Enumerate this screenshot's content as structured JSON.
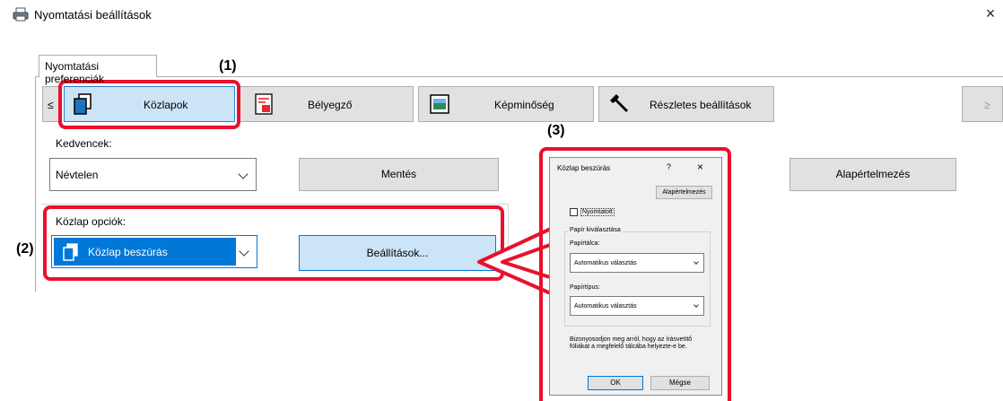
{
  "window": {
    "title": "Nyomtatási beállítások",
    "close_glyph": "×"
  },
  "tab": {
    "label": "Nyomtatási preferenciák"
  },
  "toolbar": {
    "prev_glyph": "≤",
    "next_glyph": "≥",
    "buttons": [
      {
        "label": "Közlapok",
        "icon": "cover-pages-icon"
      },
      {
        "label": "Bélyegző",
        "icon": "stamp-icon"
      },
      {
        "label": "Képminőség",
        "icon": "image-quality-icon"
      },
      {
        "label": "Részletes beállítások",
        "icon": "wrench-icon"
      }
    ]
  },
  "favorites": {
    "label": "Kedvencek:",
    "value": "Névtelen",
    "save_label": "Mentés",
    "default_label": "Alapértelmezés"
  },
  "cover_options": {
    "label": "Közlap opciók:",
    "value": "Közlap beszúrás",
    "settings_label": "Beállítások..."
  },
  "callouts": {
    "one": "(1)",
    "two": "(2)",
    "three": "(3)"
  },
  "dialog": {
    "title": "Közlap beszúrás",
    "help_glyph": "?",
    "close_glyph": "×",
    "default_label": "Alapértelmezés",
    "printed_label": "Nyomtatott",
    "paper_selection_label": "Papír kiválasztása",
    "tray_label": "Papírtálca:",
    "tray_value": "Automatikus választás",
    "type_label": "Papírtípus:",
    "type_value": "Automatikus választás",
    "note": "Bizonyosodjon meg arról, hogy az írásvetítő fóliákat a megfelelő tálcába helyezte-e be.",
    "ok_label": "OK",
    "cancel_label": "Mégse"
  },
  "colors": {
    "callout_red": "#e8112d",
    "selected_blue": "#1e73be"
  }
}
